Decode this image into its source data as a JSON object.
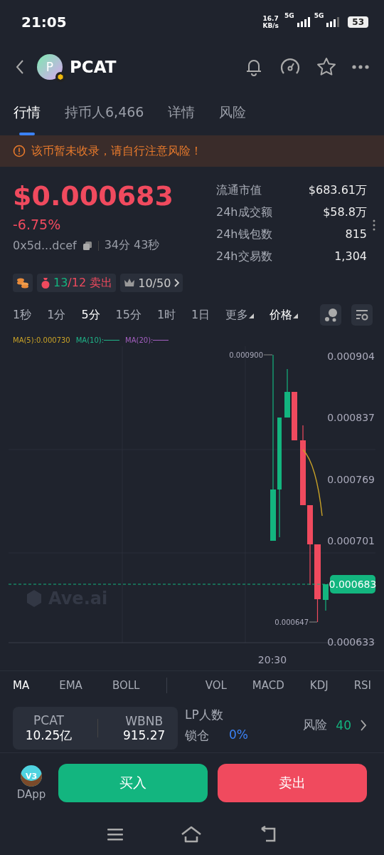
{
  "status_bar": {
    "time": "21:05",
    "speed": "16.7",
    "speed_unit": "KB/s",
    "network_1": "5G",
    "network_2": "5G",
    "battery": "53"
  },
  "header": {
    "avatar_letter": "P",
    "title": "PCAT"
  },
  "tabs": [
    {
      "label": "行情",
      "selected": true
    },
    {
      "label": "持币人6,466",
      "selected": false
    },
    {
      "label": "详情",
      "selected": false
    },
    {
      "label": "风险",
      "selected": false
    }
  ],
  "warning": "该币暂未收录，请自行注意风险！",
  "price": {
    "value": "$0.000683",
    "change": "-6.75%",
    "address": "0x5d...dcef",
    "age": "34分 43秒"
  },
  "stats": [
    {
      "label": "流通市值",
      "value": "$683.61万"
    },
    {
      "label": "24h成交额",
      "value": "$58.8万"
    },
    {
      "label": "24h钱包数",
      "value": "815"
    },
    {
      "label": "24h交易数",
      "value": "1,304"
    }
  ],
  "badges": {
    "trades": {
      "buys": "13",
      "sells": "/12 卖出"
    },
    "top": "10/50"
  },
  "timeframes": [
    {
      "label": "1秒",
      "selected": false
    },
    {
      "label": "1分",
      "selected": false
    },
    {
      "label": "5分",
      "selected": true
    },
    {
      "label": "15分",
      "selected": false
    },
    {
      "label": "1时",
      "selected": false
    },
    {
      "label": "1日",
      "selected": false
    },
    {
      "label": "更多",
      "selected": false
    }
  ],
  "chart_type": "价格",
  "chart": {
    "legend": [
      {
        "label": "MA(5):0.000730",
        "color": "#c9a227",
        "line": false
      },
      {
        "label": "MA(10):",
        "color": "#1fb589",
        "line": true
      },
      {
        "label": "MA(20):",
        "color": "#a45fc0",
        "line": true
      }
    ],
    "y_ticks": [
      "0.000904",
      "0.000837",
      "0.000769",
      "0.000701",
      "0.000633"
    ],
    "high_label": "0.000900",
    "low_label": "0.000647",
    "current": "0.000683",
    "x_label": "20:30",
    "watermark": "Ave.ai"
  },
  "indicators": [
    [
      {
        "label": "MA",
        "selected": true
      },
      {
        "label": "EMA",
        "selected": false
      },
      {
        "label": "BOLL",
        "selected": false
      }
    ],
    [
      {
        "label": "VOL",
        "selected": false
      },
      {
        "label": "MACD",
        "selected": false
      },
      {
        "label": "KDJ",
        "selected": false
      },
      {
        "label": "RSI",
        "selected": false
      }
    ]
  ],
  "pool": [
    {
      "token": "PCAT",
      "amount": "10.25亿"
    },
    {
      "token": "WBNB",
      "amount": "915.27"
    }
  ],
  "lp": {
    "label": "LP人数",
    "lock_label": "锁仓",
    "lock_value": "0%",
    "risk_label": "风险",
    "risk_value": "40"
  },
  "actions": {
    "dapp": "DApp",
    "badge": "V3",
    "buy": "买入",
    "sell": "卖出"
  }
}
